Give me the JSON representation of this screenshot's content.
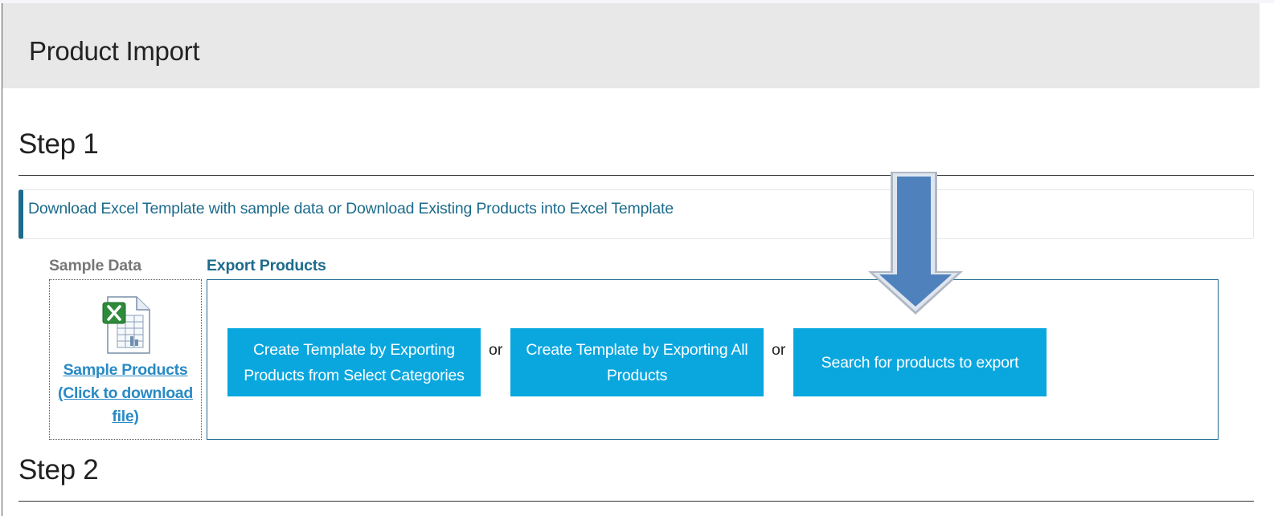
{
  "header": {
    "title": "Product Import"
  },
  "step1": {
    "title": "Step 1",
    "info_text": "Download Excel Template with sample data or Download Existing Products into Excel Template",
    "sample_data": {
      "label": "Sample Data",
      "icon": "excel-file-icon",
      "link_lines": [
        "Sample Products",
        "(Click to download",
        "file)"
      ]
    },
    "export_products": {
      "label": "Export Products",
      "buttons": [
        {
          "label_lines": [
            "Create Template by Exporting",
            "Products from Select Categories"
          ]
        },
        {
          "label_lines": [
            "Create Template by Exporting All",
            "Products"
          ]
        },
        {
          "label_lines": [
            "Search for products to export"
          ]
        }
      ],
      "separator": "or"
    },
    "annotation": {
      "icon": "down-arrow-icon",
      "color": "#4f81bd"
    }
  },
  "step2": {
    "title": "Step 2"
  },
  "colors": {
    "header_bg": "#e8e8e8",
    "accent": "#1d6b8c",
    "button_bg": "#0aa7df",
    "link": "#2a8ac4",
    "muted_label": "#777777"
  }
}
